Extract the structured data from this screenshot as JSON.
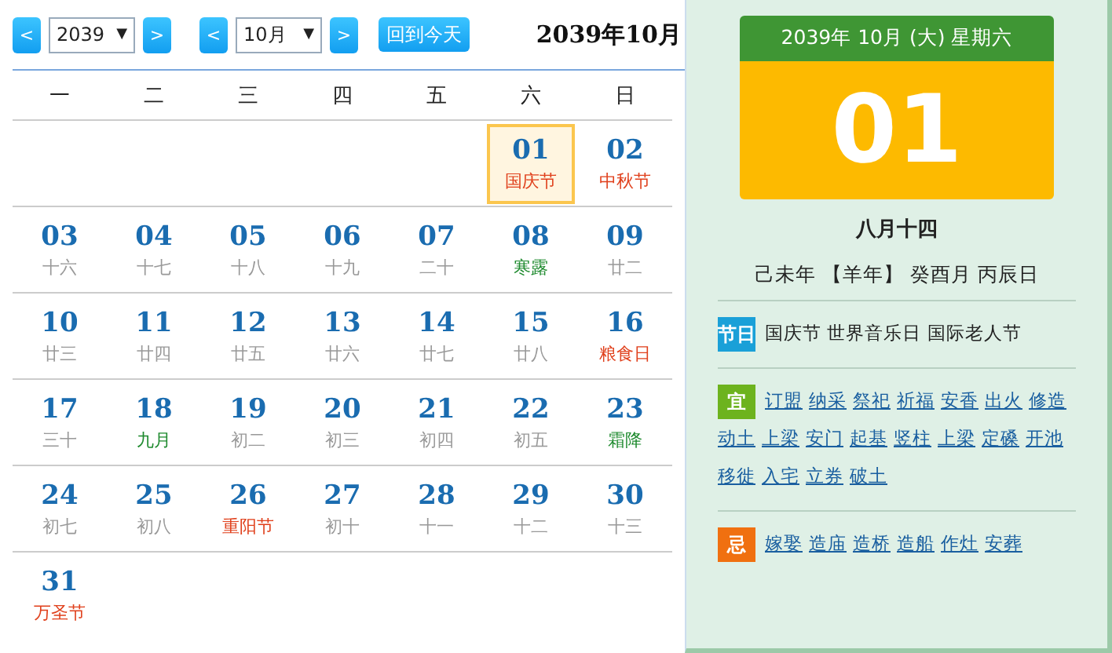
{
  "toolbar": {
    "prev_year": "<",
    "year": {
      "value": "2039",
      "caret": "▼"
    },
    "next_year": ">",
    "prev_month": "<",
    "month": {
      "value": "10月",
      "caret": "▼"
    },
    "next_month": ">",
    "today_button": "回到今天",
    "title": "2039年10月"
  },
  "weekdays": [
    "一",
    "二",
    "三",
    "四",
    "五",
    "六",
    "日"
  ],
  "weeks": [
    [
      {
        "day": "01",
        "sub": "国庆节",
        "kind": "festival",
        "selected": true
      },
      {
        "day": "02",
        "sub": "中秋节",
        "kind": "festival",
        "selected": false
      }
    ],
    [
      {
        "day": "03",
        "sub": "十六",
        "kind": "lunar",
        "selected": false
      },
      {
        "day": "04",
        "sub": "十七",
        "kind": "lunar",
        "selected": false
      },
      {
        "day": "05",
        "sub": "十八",
        "kind": "lunar",
        "selected": false
      },
      {
        "day": "06",
        "sub": "十九",
        "kind": "lunar",
        "selected": false
      },
      {
        "day": "07",
        "sub": "二十",
        "kind": "lunar",
        "selected": false
      },
      {
        "day": "08",
        "sub": "寒露",
        "kind": "term",
        "selected": false
      },
      {
        "day": "09",
        "sub": "廿二",
        "kind": "lunar",
        "selected": false
      }
    ],
    [
      {
        "day": "10",
        "sub": "廿三",
        "kind": "lunar",
        "selected": false
      },
      {
        "day": "11",
        "sub": "廿四",
        "kind": "lunar",
        "selected": false
      },
      {
        "day": "12",
        "sub": "廿五",
        "kind": "lunar",
        "selected": false
      },
      {
        "day": "13",
        "sub": "廿六",
        "kind": "lunar",
        "selected": false
      },
      {
        "day": "14",
        "sub": "廿七",
        "kind": "lunar",
        "selected": false
      },
      {
        "day": "15",
        "sub": "廿八",
        "kind": "lunar",
        "selected": false
      },
      {
        "day": "16",
        "sub": "粮食日",
        "kind": "festival",
        "selected": false
      }
    ],
    [
      {
        "day": "17",
        "sub": "三十",
        "kind": "lunar",
        "selected": false
      },
      {
        "day": "18",
        "sub": "九月",
        "kind": "term",
        "selected": false
      },
      {
        "day": "19",
        "sub": "初二",
        "kind": "lunar",
        "selected": false
      },
      {
        "day": "20",
        "sub": "初三",
        "kind": "lunar",
        "selected": false
      },
      {
        "day": "21",
        "sub": "初四",
        "kind": "lunar",
        "selected": false
      },
      {
        "day": "22",
        "sub": "初五",
        "kind": "lunar",
        "selected": false
      },
      {
        "day": "23",
        "sub": "霜降",
        "kind": "term",
        "selected": false
      }
    ],
    [
      {
        "day": "24",
        "sub": "初七",
        "kind": "lunar",
        "selected": false
      },
      {
        "day": "25",
        "sub": "初八",
        "kind": "lunar",
        "selected": false
      },
      {
        "day": "26",
        "sub": "重阳节",
        "kind": "festival",
        "selected": false
      },
      {
        "day": "27",
        "sub": "初十",
        "kind": "lunar",
        "selected": false
      },
      {
        "day": "28",
        "sub": "十一",
        "kind": "lunar",
        "selected": false
      },
      {
        "day": "29",
        "sub": "十二",
        "kind": "lunar",
        "selected": false
      },
      {
        "day": "30",
        "sub": "十三",
        "kind": "lunar",
        "selected": false
      }
    ],
    [
      {
        "day": "31",
        "sub": "万圣节",
        "kind": "festival",
        "selected": false
      }
    ]
  ],
  "detail": {
    "header": "2039年 10月 (大) 星期六",
    "day": "01",
    "lunar_date": "八月十四",
    "ganzhi": "己未年 【羊年】 癸酉月 丙辰日",
    "festivals": {
      "label": "节日",
      "text": "国庆节 世界音乐日 国际老人节"
    },
    "yi": {
      "label": "宜",
      "items": [
        "订盟",
        "纳采",
        "祭祀",
        "祈福",
        "安香",
        "出火",
        "修造",
        "动土",
        "上梁",
        "安门",
        "起基",
        "竖柱",
        "上梁",
        "定磉",
        "开池",
        "移徙",
        "入宅",
        "立券",
        "破土"
      ]
    },
    "ji": {
      "label": "忌",
      "items": [
        "嫁娶",
        "造庙",
        "造桥",
        "造船",
        "作灶",
        "安葬"
      ]
    }
  }
}
